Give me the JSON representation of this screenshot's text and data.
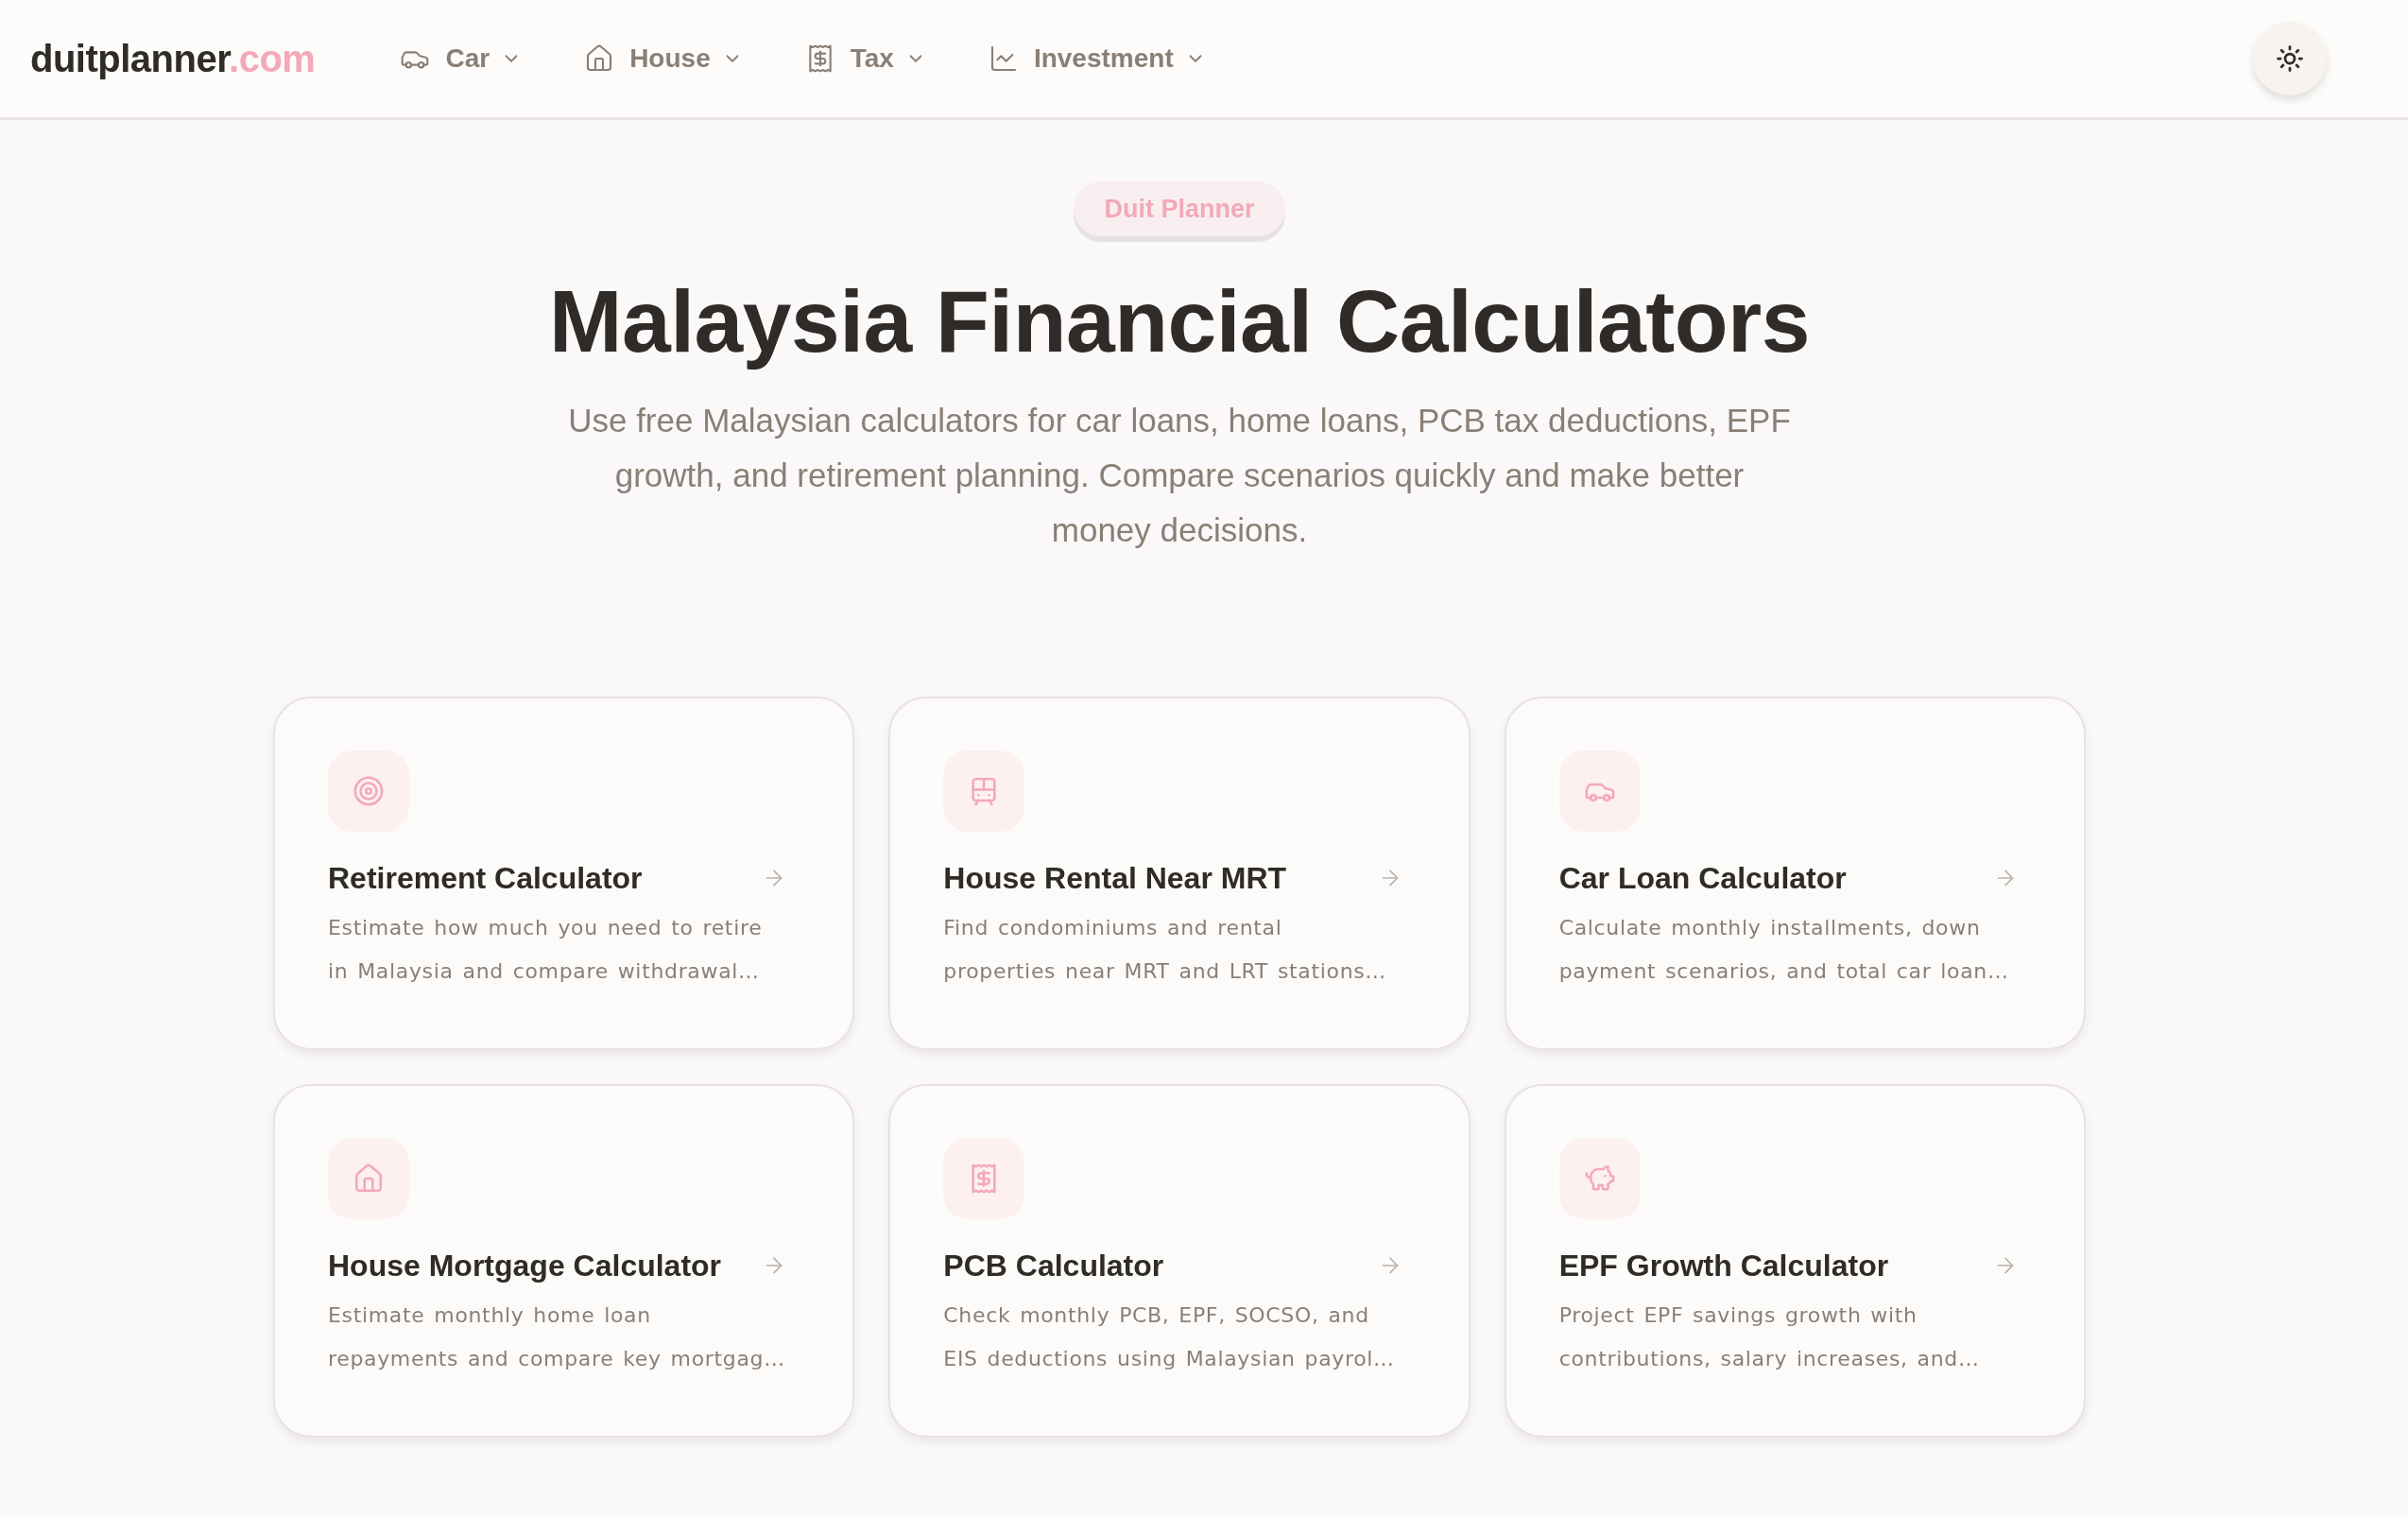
{
  "nav": {
    "logo": {
      "name": "duitplanner",
      "suffix": ".com"
    },
    "menu": [
      {
        "label": "Car"
      },
      {
        "label": "House"
      },
      {
        "label": "Tax"
      },
      {
        "label": "Investment"
      }
    ]
  },
  "hero": {
    "badge": "Duit Planner",
    "title": "Malaysia Financial Calculators",
    "subtitle": "Use free Malaysian calculators for car loans, home loans, PCB tax deductions, EPF growth, and retirement planning. Compare scenarios quickly and make better money decisions."
  },
  "cards": [
    {
      "title": "Retirement Calculator",
      "description": "Estimate how much you need to retire in Malaysia and compare withdrawal…"
    },
    {
      "title": "House Rental Near MRT",
      "description": "Find condominiums and rental properties near MRT and LRT stations…"
    },
    {
      "title": "Car Loan Calculator",
      "description": "Calculate monthly installments, down payment scenarios, and total car loan…"
    },
    {
      "title": "House Mortgage Calculator",
      "description": "Estimate monthly home loan repayments and compare key mortgag…"
    },
    {
      "title": "PCB Calculator",
      "description": "Check monthly PCB, EPF, SOCSO, and EIS deductions using Malaysian payrol…"
    },
    {
      "title": "EPF Growth Calculator",
      "description": "Project EPF savings growth with contributions, salary increases, and…"
    }
  ]
}
